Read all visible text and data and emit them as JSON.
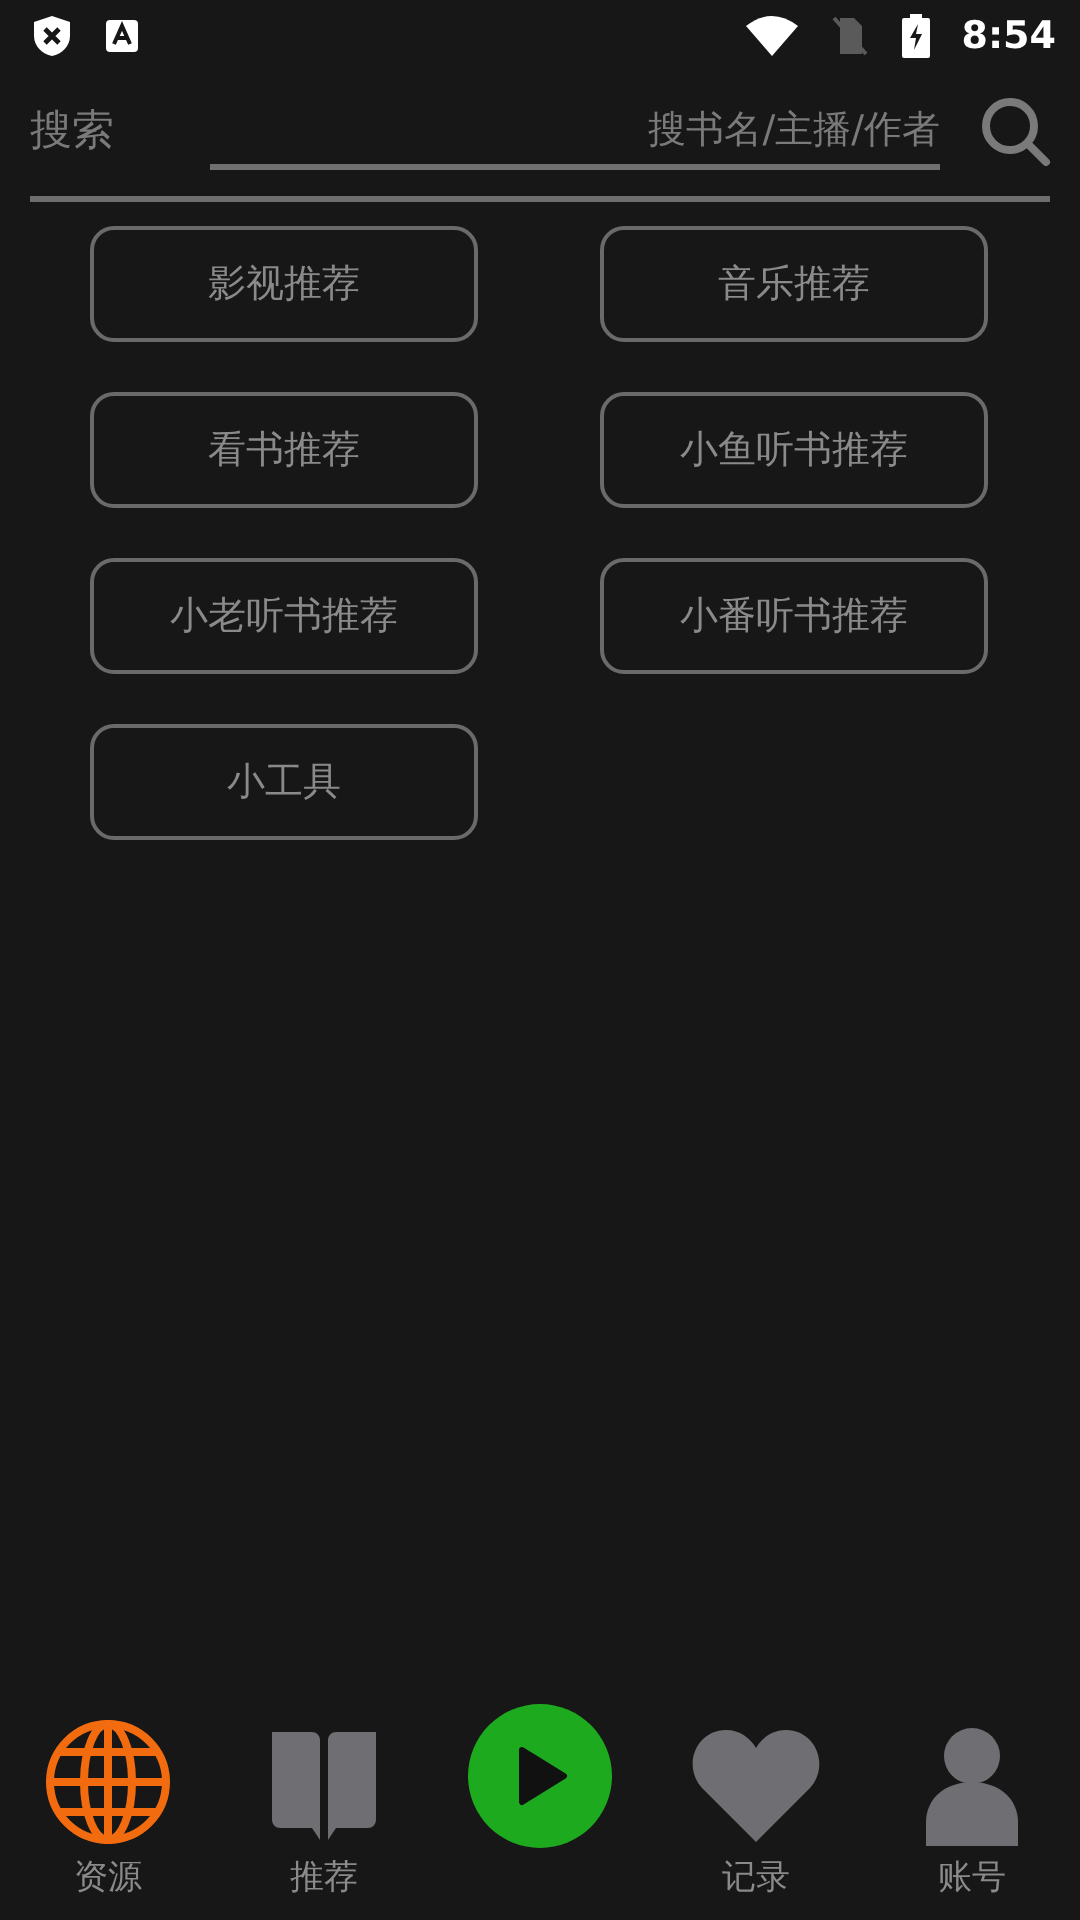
{
  "status_bar": {
    "time": "8:54"
  },
  "search": {
    "label": "搜索",
    "placeholder": "搜书名/主播/作者"
  },
  "categories": [
    "影视推荐",
    "音乐推荐",
    "看书推荐",
    "小鱼听书推荐",
    "小老听书推荐",
    "小番听书推荐",
    "小工具"
  ],
  "bottom_nav": [
    {
      "kind": "globe",
      "label": "资源",
      "selected": true
    },
    {
      "kind": "book",
      "label": "推荐",
      "selected": false
    },
    {
      "kind": "play"
    },
    {
      "kind": "heart",
      "label": "记录",
      "selected": false
    },
    {
      "kind": "person",
      "label": "账号",
      "selected": false
    }
  ]
}
